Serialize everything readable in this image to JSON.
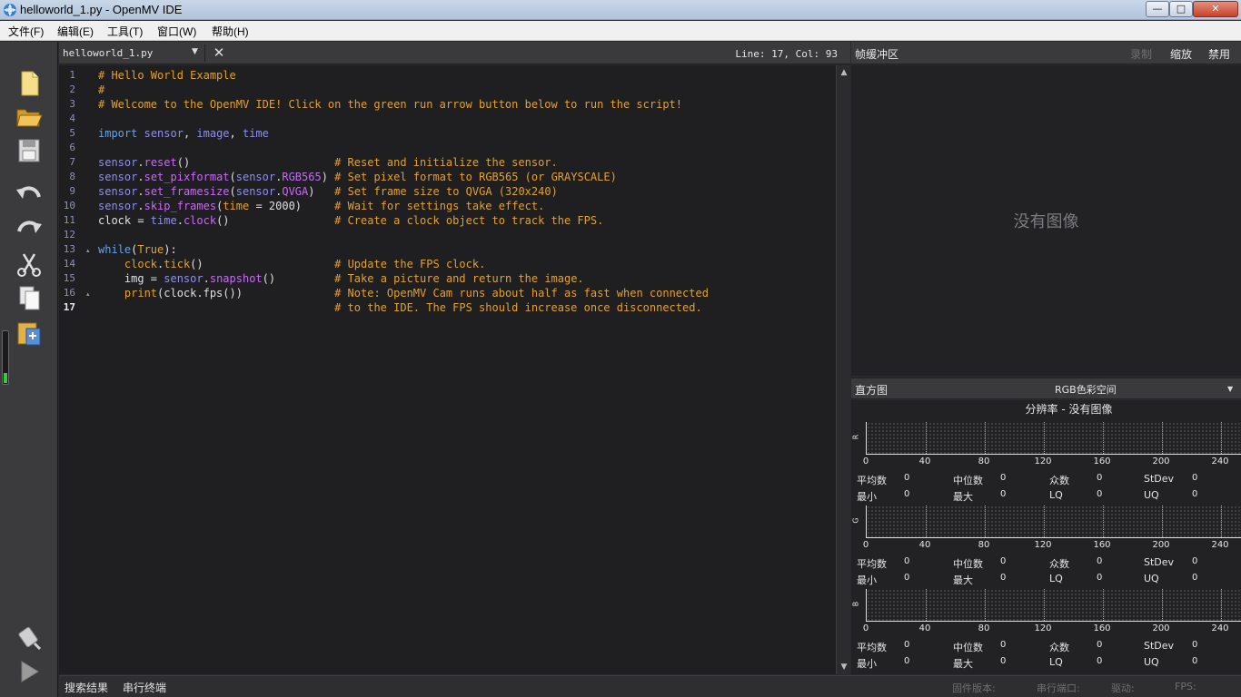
{
  "window": {
    "title": "helloworld_1.py - OpenMV IDE",
    "min": "—",
    "max": "□",
    "close": "✕"
  },
  "menu": [
    {
      "label": "文件(F)"
    },
    {
      "label": "编辑(E)"
    },
    {
      "label": "工具(T)"
    },
    {
      "label": "窗口(W)"
    },
    {
      "label": "帮助(H)"
    }
  ],
  "toolbar": {
    "icons": [
      "new-file-icon",
      "open-folder-icon",
      "save-icon",
      "undo-icon",
      "redo-icon",
      "cut-icon",
      "copy-icon",
      "paste-icon",
      "connect-icon",
      "run-icon"
    ],
    "meter_level": 0.2
  },
  "editor": {
    "tab_file": "helloworld_1.py",
    "tab_dropdown": "▼",
    "tab_close": "✕",
    "line_col": "Line: 17, Col: 93",
    "current_line": 17,
    "fold_marker": "▴",
    "line_numbers": [
      "1",
      "2",
      "3",
      "4",
      "5",
      "6",
      "7",
      "8",
      "9",
      "10",
      "11",
      "12",
      "13",
      "14",
      "15",
      "16",
      "17"
    ],
    "colors": {
      "comment": "#e2a22e",
      "keyword": "#6aa1e0",
      "attribute": "#c56cf0",
      "sensor": "#8f8fe8"
    }
  },
  "bottom": {
    "tabs": [
      "搜索结果",
      "串行终端"
    ],
    "status": [
      "固件版本:",
      "串行端口:",
      "驱动:",
      "FPS:"
    ]
  },
  "framebuffer": {
    "title": "帧缓冲区",
    "record": "录制",
    "zoom": "缩放",
    "disable": "禁用",
    "no_image": "没有图像"
  },
  "histogram": {
    "title": "直方图",
    "colorspace": "RGB色彩空间",
    "dropdown": "▼",
    "resolution": "分辨率 - 没有图像",
    "ticks": [
      "0",
      "40",
      "80",
      "120",
      "160",
      "200",
      "240"
    ],
    "channels": [
      {
        "label": "R",
        "row1": [
          "平均数",
          "0",
          "中位数",
          "0",
          "众数",
          "0",
          "StDev",
          "0"
        ],
        "row2": [
          "最小",
          "0",
          "最大",
          "0",
          "LQ",
          "0",
          "UQ",
          "0"
        ]
      },
      {
        "label": "G",
        "row1": [
          "平均数",
          "0",
          "中位数",
          "0",
          "众数",
          "0",
          "StDev",
          "0"
        ],
        "row2": [
          "最小",
          "0",
          "最大",
          "0",
          "LQ",
          "0",
          "UQ",
          "0"
        ]
      },
      {
        "label": "B",
        "row1": [
          "平均数",
          "0",
          "中位数",
          "0",
          "众数",
          "0",
          "StDev",
          "0"
        ],
        "row2": [
          "最小",
          "0",
          "最大",
          "0",
          "LQ",
          "0",
          "UQ",
          "0"
        ]
      }
    ]
  }
}
